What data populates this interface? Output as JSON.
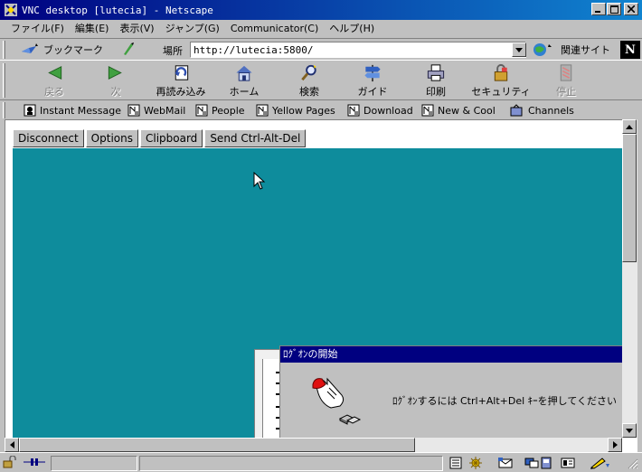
{
  "window": {
    "title": "VNC desktop [lutecia] - Netscape"
  },
  "menu": [
    "ファイル(F)",
    "編集(E)",
    "表示(V)",
    "ジャンプ(G)",
    "Communicator(C)",
    "ヘルプ(H)"
  ],
  "location": {
    "bookmarks_label": "ブックマーク",
    "location_label": "場所",
    "url": "http://lutecia:5800/",
    "related_label": "関連サイト"
  },
  "nav": [
    {
      "label": "戻る",
      "icon": "back-icon",
      "enabled": false
    },
    {
      "label": "次",
      "icon": "forward-icon",
      "enabled": false
    },
    {
      "label": "再読み込み",
      "icon": "reload-icon",
      "enabled": true
    },
    {
      "label": "ホーム",
      "icon": "home-icon",
      "enabled": true
    },
    {
      "label": "検索",
      "icon": "search-icon",
      "enabled": true
    },
    {
      "label": "ガイド",
      "icon": "guide-icon",
      "enabled": true
    },
    {
      "label": "印刷",
      "icon": "print-icon",
      "enabled": true
    },
    {
      "label": "セキュリティ",
      "icon": "security-icon",
      "enabled": true
    },
    {
      "label": "停止",
      "icon": "stop-icon",
      "enabled": false
    }
  ],
  "personal": [
    "Instant Message",
    "WebMail",
    "People",
    "Yellow Pages",
    "Download",
    "New & Cool",
    "Channels"
  ],
  "vnc": {
    "buttons": [
      "Disconnect",
      "Options",
      "Clipboard",
      "Send Ctrl-Alt-Del"
    ]
  },
  "dialog": {
    "title": "ﾛｸﾞｵﾝの開始",
    "message": "ﾛｸﾞｵﾝするには Ctrl+Alt+Del ｷｰを押してください"
  },
  "colors": {
    "desktop": "#0e8c9c",
    "titlebar": "#000080"
  }
}
